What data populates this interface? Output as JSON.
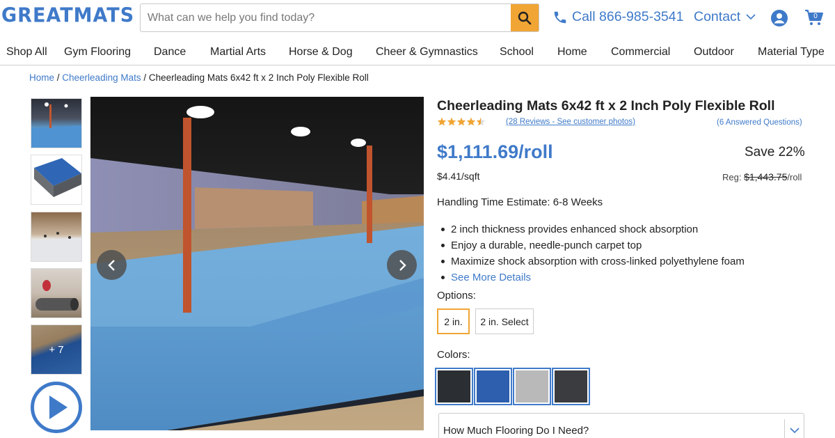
{
  "header": {
    "logo_text": "GREATMATS",
    "search_placeholder": "What can we help you find today?",
    "phone": "Call 866-985-3541",
    "contact": "Contact",
    "cart_count": "0"
  },
  "nav": {
    "items": [
      "Shop All",
      "Gym Flooring",
      "Dance",
      "Martial Arts",
      "Horse & Dog",
      "Cheer & Gymnastics",
      "School",
      "Home",
      "Commercial",
      "Outdoor",
      "Material Type"
    ]
  },
  "breadcrumb": {
    "home": "Home",
    "category": "Cheerleading Mats",
    "current": "Cheerleading Mats 6x42 ft x 2 Inch Poly Flexible Roll"
  },
  "gallery": {
    "more_label": "+ 7"
  },
  "product": {
    "title": "Cheerleading Mats 6x42 ft x 2 Inch Poly Flexible Roll",
    "rating": 4.5,
    "reviews": "(28 Reviews - See customer photos)",
    "questions": "(6 Answered Questions)",
    "price": "$1,111.69/roll",
    "save": "Save 22%",
    "per_sqft": "$4.41/sqft",
    "reg_label": "Reg:",
    "reg_price": "$1,443.75",
    "reg_unit": "/roll",
    "handling": "Handling Time Estimate: 6-8 Weeks",
    "bullets": [
      "2 inch thickness provides enhanced shock absorption",
      "Enjoy a durable, needle-punch carpet top",
      "Maximize shock absorption with cross-linked polyethylene foam"
    ],
    "see_more": "See More Details",
    "options_label": "Options:",
    "options": [
      "2 in.",
      "2 in. Select"
    ],
    "colors_label": "Colors:",
    "colors": [
      "#2b2e33",
      "#2d5fae",
      "#b9b9b9",
      "#3a3c40"
    ],
    "accordion_title": "How Much Flooring Do I Need?"
  },
  "theme": {
    "brand_blue": "#3f7ac9",
    "accent_orange": "#f0a534",
    "star_color": "#f0a534"
  }
}
